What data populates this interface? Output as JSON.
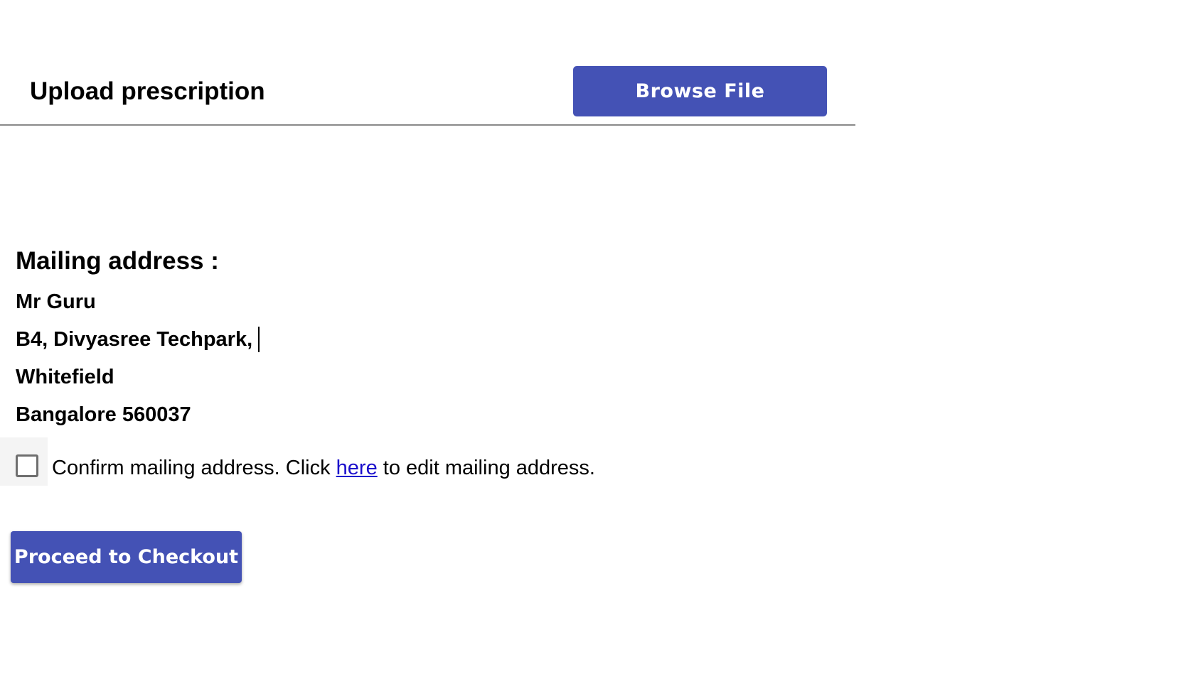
{
  "upload": {
    "title": "Upload prescription",
    "browse_label": "Browse File"
  },
  "mailing": {
    "heading": "Mailing address :",
    "lines": [
      "Mr Guru",
      "B4, Divyasree Techpark,",
      "Whitefield",
      "Bangalore 560037"
    ]
  },
  "confirm": {
    "checked": false,
    "text_before": "Confirm mailing address. Click ",
    "link_text": "here",
    "text_after": " to edit mailing address."
  },
  "checkout": {
    "label": "Proceed to Checkout"
  },
  "colors": {
    "button_bg": "#4452b5",
    "link": "#1a0dcc"
  }
}
